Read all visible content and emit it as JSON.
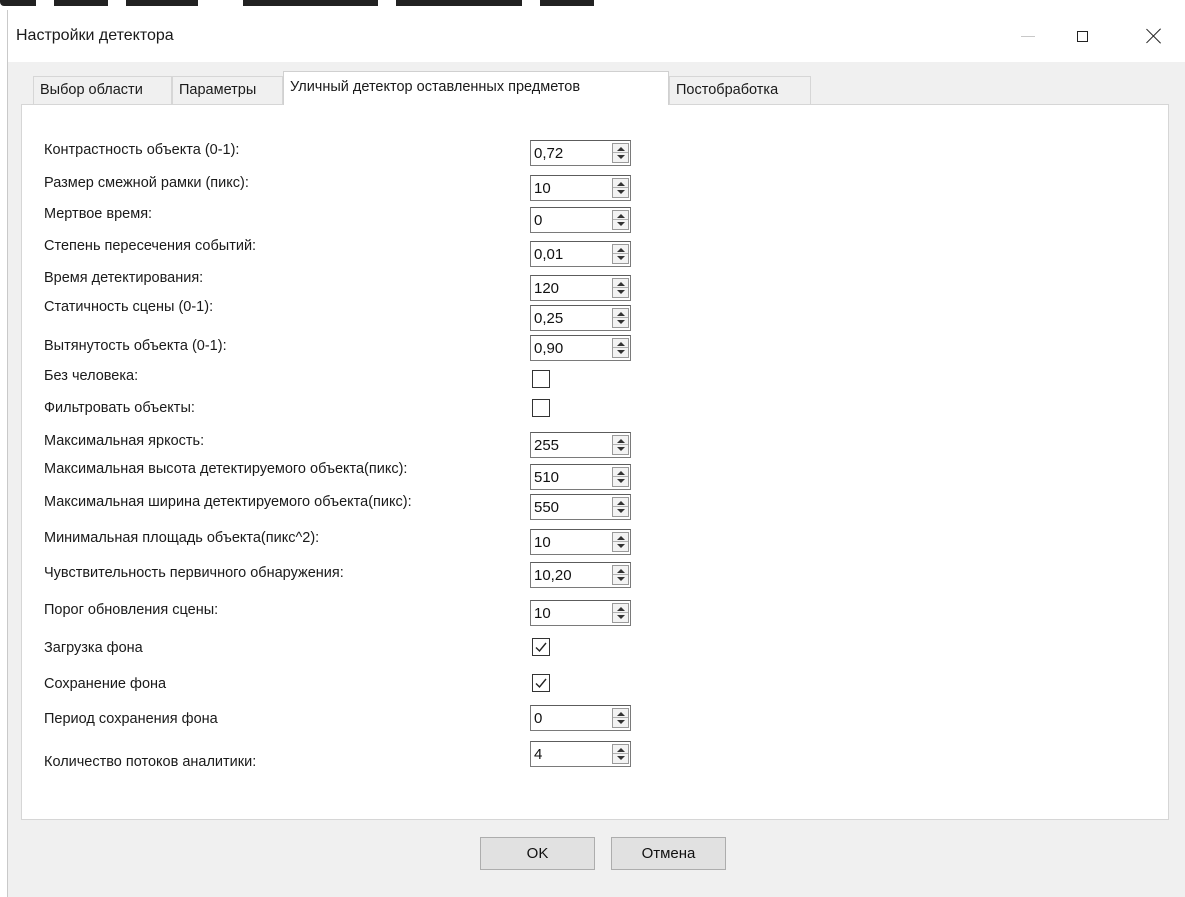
{
  "window": {
    "title": "Настройки детектора"
  },
  "tabs": [
    {
      "label": "Выбор области",
      "active": false
    },
    {
      "label": "Параметры",
      "active": false
    },
    {
      "label": "Уличный детектор оставленных предметов",
      "active": true
    },
    {
      "label": "Постобработка",
      "active": false
    }
  ],
  "settings": [
    {
      "label": "Контрастность объекта (0-1):",
      "type": "spin",
      "value": "0,72"
    },
    {
      "label": "Размер смежной рамки (пикс):",
      "type": "spin",
      "value": "10"
    },
    {
      "label": "Мертвое время:",
      "type": "spin",
      "value": "0"
    },
    {
      "label": "Степень пересечения событий:",
      "type": "spin",
      "value": "0,01"
    },
    {
      "label": "Время детектирования:",
      "type": "spin",
      "value": "120"
    },
    {
      "label": "Статичность сцены (0-1):",
      "type": "spin",
      "value": "0,25"
    },
    {
      "label": "Вытянутость объекта (0-1):",
      "type": "spin",
      "value": "0,90"
    },
    {
      "label": "Без человека:",
      "type": "checkbox",
      "checked": false
    },
    {
      "label": "Фильтровать объекты:",
      "type": "checkbox",
      "checked": false
    },
    {
      "label": "Максимальная яркость:",
      "type": "spin",
      "value": "255"
    },
    {
      "label": "Максимальная высота детектируемого объекта(пикс):",
      "type": "spin",
      "value": "510"
    },
    {
      "label": "Максимальная ширина детектируемого объекта(пикс):",
      "type": "spin",
      "value": "550"
    },
    {
      "label": "Минимальная площадь объекта(пикс^2):",
      "type": "spin",
      "value": "10"
    },
    {
      "label": "Чувствительность первичного обнаружения:",
      "type": "spin",
      "value": "10,20"
    },
    {
      "label": "Порог обновления сцены:",
      "type": "spin",
      "value": "10"
    },
    {
      "label": "Загрузка фона",
      "type": "checkbox",
      "checked": true
    },
    {
      "label": "Сохранение фона",
      "type": "checkbox",
      "checked": true
    },
    {
      "label": "Период сохранения фона",
      "type": "spin",
      "value": "0"
    },
    {
      "label": "Количество потоков аналитики:",
      "type": "spin",
      "value": "4"
    }
  ],
  "footer": {
    "ok_label": "OK",
    "cancel_label": "Отмена"
  }
}
